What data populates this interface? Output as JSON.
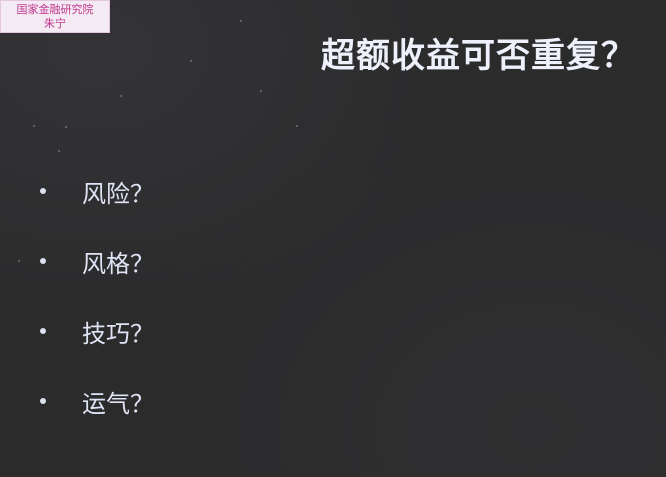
{
  "watermark": {
    "line1": "国家金融研究院",
    "line2": "朱宁"
  },
  "slide": {
    "title": "超额收益可否重复？",
    "bullets": [
      {
        "text": "风险？"
      },
      {
        "text": "风格？"
      },
      {
        "text": "技巧？"
      },
      {
        "text": "运气？"
      }
    ]
  }
}
